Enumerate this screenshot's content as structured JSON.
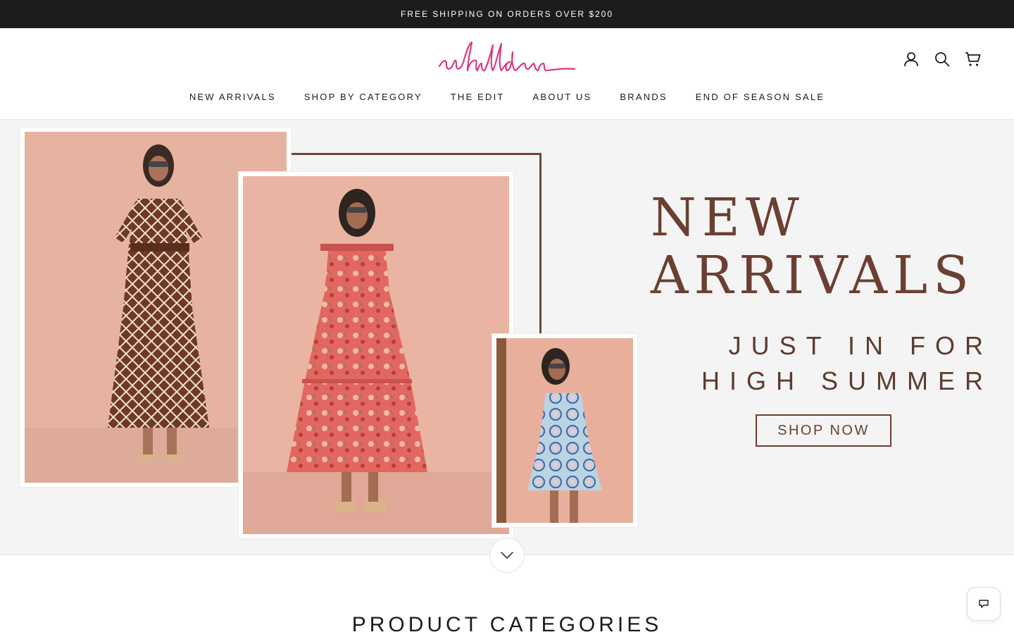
{
  "announcement": {
    "text": "FREE SHIPPING ON ORDERS OVER $200"
  },
  "header": {
    "logo_text": "whilden",
    "icons": [
      "account-icon",
      "search-icon",
      "cart-icon"
    ]
  },
  "nav": {
    "items": [
      {
        "label": "NEW ARRIVALS"
      },
      {
        "label": "SHOP BY CATEGORY"
      },
      {
        "label": "THE EDIT"
      },
      {
        "label": "ABOUT US"
      },
      {
        "label": "BRANDS"
      },
      {
        "label": "END OF SEASON SALE"
      }
    ]
  },
  "hero": {
    "title_line1": "NEW",
    "title_line2": "ARRIVALS",
    "subtitle_line1": "JUST IN FOR",
    "subtitle_line2": "HIGH SUMMER",
    "cta_label": "SHOP NOW",
    "colors": {
      "accent": "#6b3f32",
      "photo_bg": "#e9b6a5"
    }
  },
  "scroll_icon": "chevron-down-icon",
  "section": {
    "title": "PRODUCT CATEGORIES"
  },
  "chat_icon": "chat-icon"
}
